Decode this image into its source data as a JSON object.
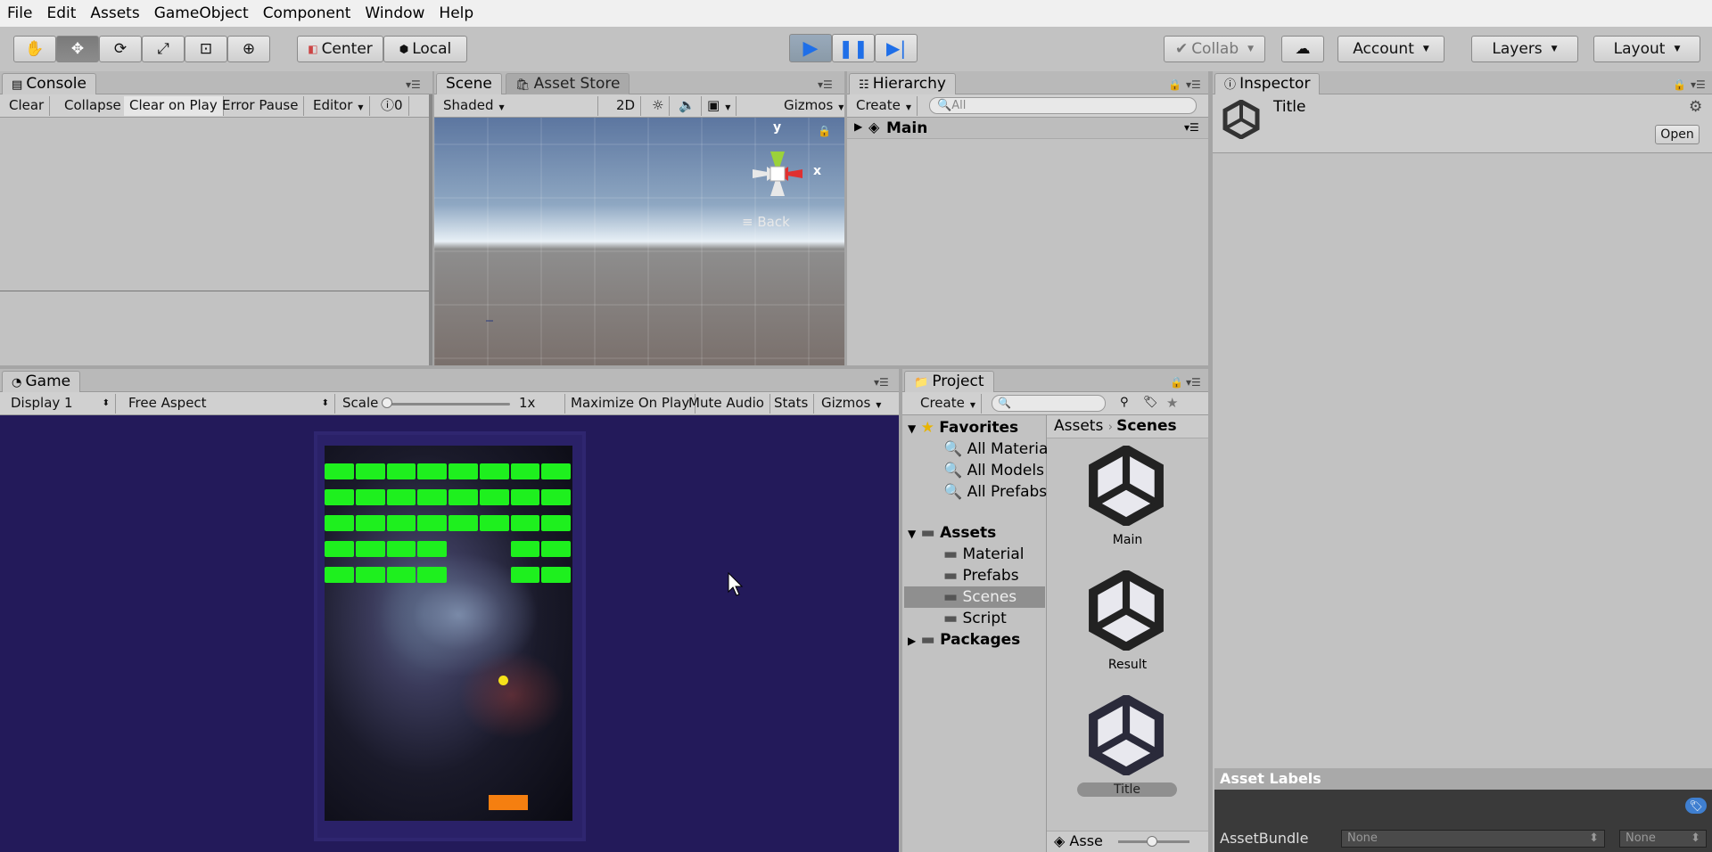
{
  "menu": [
    "File",
    "Edit",
    "Assets",
    "GameObject",
    "Component",
    "Window",
    "Help"
  ],
  "toolbar": {
    "tools": [
      "hand-icon",
      "move-icon",
      "rotate-icon",
      "scale-icon",
      "rect-icon",
      "transform-icon"
    ],
    "pivot": "Center",
    "space": "Local",
    "collab": "Collab",
    "account": "Account",
    "layers": "Layers",
    "layout": "Layout"
  },
  "console": {
    "tab": "Console",
    "buttons": [
      "Clear",
      "Collapse",
      "Clear on Play",
      "Error Pause",
      "Editor"
    ],
    "count": "0"
  },
  "scene": {
    "tab": "Scene",
    "tab2": "Asset Store",
    "shading": "Shaded",
    "mode2d": "2D",
    "gizmos": "Gizmos",
    "axis_y": "y",
    "axis_x": "x",
    "view": "Back"
  },
  "hierarchy": {
    "tab": "Hierarchy",
    "create": "Create",
    "search_placeholder": "All",
    "root": "Main"
  },
  "inspector": {
    "tab": "Inspector",
    "title": "Title",
    "open": "Open",
    "asset_labels": "Asset Labels",
    "assetbundle_label": "AssetBundle",
    "bundle_value": "None",
    "variant_value": "None"
  },
  "game": {
    "tab": "Game",
    "display": "Display 1",
    "aspect": "Free Aspect",
    "scale_label": "Scale",
    "scale_value": "1x",
    "buttons": [
      "Maximize On Play",
      "Mute Audio",
      "Stats",
      "Gizmos"
    ],
    "bricks": {
      "rows": 5,
      "cols": 8,
      "missing": [
        [
          3,
          4
        ],
        [
          3,
          5
        ],
        [
          4,
          4
        ],
        [
          4,
          5
        ]
      ]
    },
    "colors": {
      "brick": "#1ef01e",
      "ball": "#f5e11a",
      "paddle": "#f57f10",
      "bg": "#231a5a"
    }
  },
  "project": {
    "tab": "Project",
    "create": "Create",
    "favorites_label": "Favorites",
    "favorites": [
      "All Materia",
      "All Models",
      "All Prefabs"
    ],
    "assets_label": "Assets",
    "folders": [
      "Material",
      "Prefabs",
      "Scenes",
      "Script"
    ],
    "packages_label": "Packages",
    "breadcrumb": [
      "Assets",
      "Scenes"
    ],
    "scenes": [
      "Main",
      "Result",
      "Title"
    ],
    "footer": "Asse"
  }
}
